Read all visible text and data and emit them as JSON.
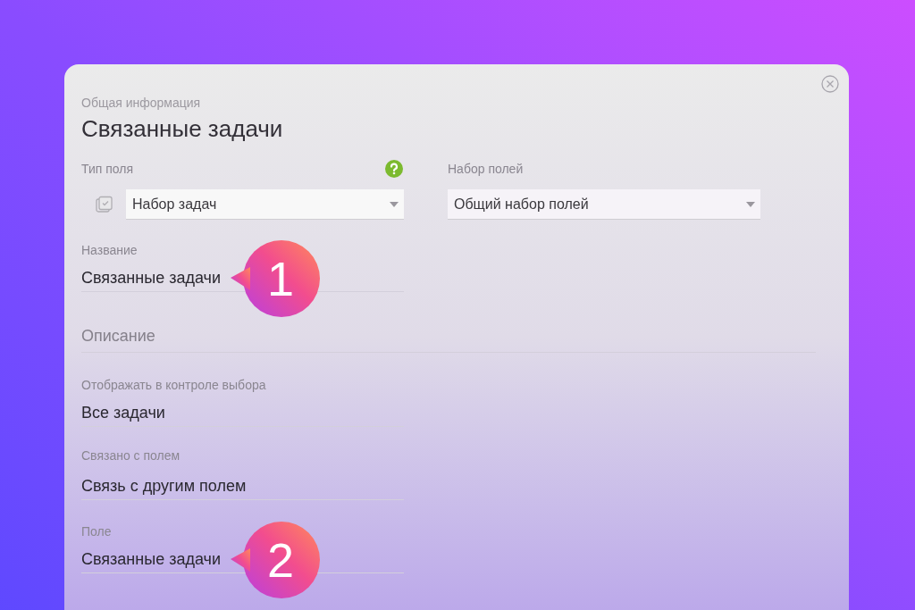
{
  "dialog": {
    "section": "Общая информация",
    "title": "Связанные задачи"
  },
  "field_type": {
    "label": "Тип поля",
    "value": "Набор задач"
  },
  "field_set": {
    "label": "Набор полей",
    "value": "Общий набор полей"
  },
  "name": {
    "label": "Название",
    "value": "Связанные задачи",
    "callout": "1"
  },
  "description": {
    "placeholder": "Описание"
  },
  "display": {
    "label": "Отображать в контроле выбора",
    "value": "Все задачи"
  },
  "linked": {
    "label": "Связано с полем",
    "value": "Связь с другим полем"
  },
  "field": {
    "label": "Поле",
    "value": "Связанные задачи",
    "callout": "2"
  }
}
